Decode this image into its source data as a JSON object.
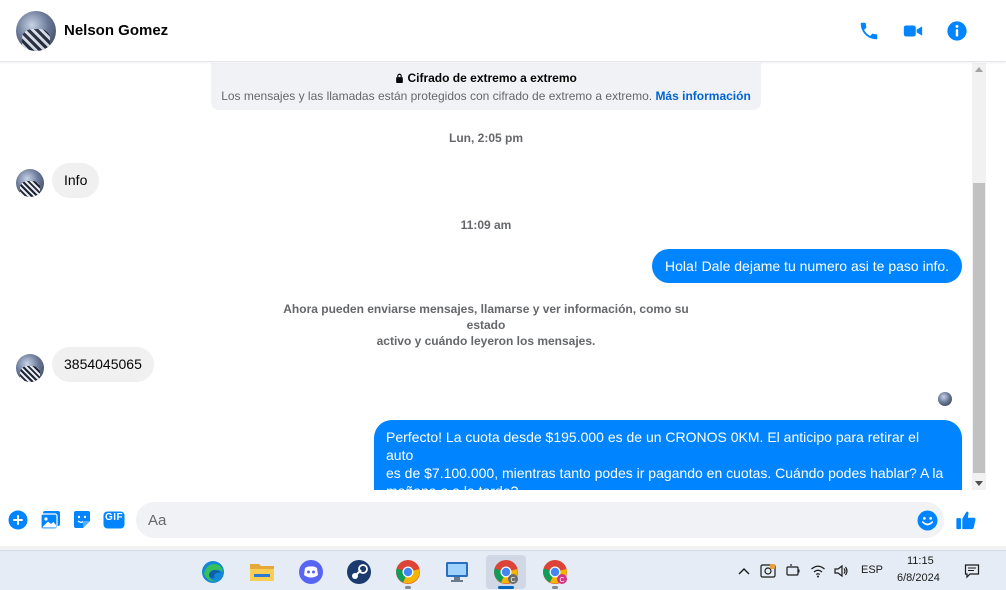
{
  "header": {
    "contact_name": "Nelson Gomez",
    "icons": [
      "phone-icon",
      "video-icon",
      "info-icon"
    ],
    "accent_color": "#0084ff"
  },
  "encryption_notice": {
    "title": "Cifrado de extremo a extremo",
    "body": "Los mensajes y las llamadas están protegidos con cifrado de extremo a extremo.",
    "link": "Más información"
  },
  "messages": {
    "stamp1": "Lun, 2:05 pm",
    "m1": "Info",
    "stamp2": "11:09 am",
    "m2": "Hola! Dale dejame tu numero  asi te paso info.",
    "system_line1": "Ahora pueden enviarse mensajes, llamarse y ver información, como su estado",
    "system_line2": "activo y cuándo leyeron los mensajes.",
    "m3": "3854045065",
    "m4_line1": "Perfecto! La cuota desde $195.000 es de un CRONOS 0KM. El anticipo para retirar el auto",
    "m4_line2": "es de $7.100.000, mientras tanto podes ir pagando en cuotas. Cuándo podes hablar? A la",
    "m4_line3": "mañana o a la tarde?"
  },
  "composer": {
    "placeholder": "Aa",
    "icons": [
      "plus-icon",
      "gallery-icon",
      "sticker-icon",
      "gif-icon",
      "emoji-icon",
      "like-icon"
    ],
    "gif_label": "GIF"
  },
  "taskbar": {
    "apps": [
      "edge-icon",
      "file-explorer-icon",
      "discord-icon",
      "steam-icon",
      "chrome-icon",
      "remote-desktop-icon",
      "chrome-profile-icon",
      "chrome-profile-icon-2"
    ],
    "language": "ESP",
    "time": "11:15",
    "date": "6/8/2024",
    "tray_icons": [
      "chevron-up-icon",
      "webcam-icon",
      "battery-icon",
      "wifi-icon",
      "volume-icon",
      "notification-icon"
    ]
  }
}
